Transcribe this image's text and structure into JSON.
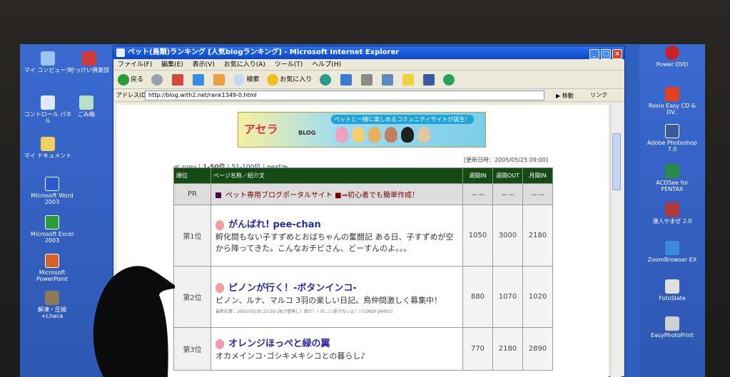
{
  "window": {
    "title": "ペット(鳥類)ランキング [人気blogランキング] - Microsoft Internet Explorer",
    "controls": [
      "_",
      "□",
      "×"
    ]
  },
  "menu": [
    "ファイル(F)",
    "編集(E)",
    "表示(V)",
    "お気に入り(A)",
    "ツール(T)",
    "ヘルプ(H)"
  ],
  "toolbar": {
    "back": "戻る",
    "search": "検索",
    "favorites": "お気に入り"
  },
  "address": {
    "label": "アドレス(D)",
    "url": "http://blog.with2.net/rank1349-0.html",
    "go": "移動",
    "links": "リンク"
  },
  "banner": {
    "logo": "アセラ",
    "blog": "BLOG",
    "tagline": "ペットと一緒に楽しめるコミュニティサイトが誕生！"
  },
  "nav": {
    "prev": "≪ prev",
    "current": "1-50位",
    "next_range": "51-100位",
    "next": "next≫"
  },
  "updated": "[更新日時：2005/05/25 09:00]",
  "table": {
    "headers": [
      "順位",
      "ページ名称／紹介文",
      "週間IN",
      "週間OUT",
      "月間IN"
    ],
    "pr": {
      "rank": "PR",
      "text": "ペット専用ブログポータルサイト ■⇒初心者でも簡単作成！",
      "values": [
        "－－",
        "－－",
        "－－"
      ]
    },
    "rows": [
      {
        "rank": "第1位",
        "title": "がんばれ! pee-chan",
        "desc": "孵化間もない子すずめとおばちゃんの奮闘記 ある日、子すずめが空から降ってきた。こんなおチビさん、どーすんのよ。。。",
        "recent": "",
        "in": "1050",
        "out": "3000",
        "month": "2180"
      },
      {
        "rank": "第2位",
        "title": "ピノンが行く！-ボタンインコ-",
        "desc": "ピノン、ルナ、マルコ 3羽の楽しい日記。鳥仲間激しく募集中！",
        "recent": "最新記事：2005/05/30 23:59 (急げ冒険し！紹介！) (5…) (あげないよ！) [CINDY JAYRO]",
        "in": "880",
        "out": "1070",
        "month": "1020"
      },
      {
        "rank": "第3位",
        "title": "オレンジほっぺと緑の翼",
        "desc": "オカメインコ･ゴシキメキシコとの暮らし♪",
        "recent": "",
        "in": "770",
        "out": "2180",
        "month": "2890"
      }
    ]
  },
  "desktop_left": [
    "マイ コンピュータ",
    "せっけい倶楽部",
    "コントロール パネル",
    "ごみ箱",
    "マイ ドキュメント",
    "Microsoft Word 2003",
    "Microsoft Excel 2003",
    "Microsoft PowerPoint",
    "解凍・圧縮 +Lhaca"
  ],
  "desktop_right": [
    "Power DVD",
    "Roxio Easy CD & DV..",
    "Adobe Photoshop 7.0",
    "ACDSee for PENTAX",
    "達人やまぜ 2.0",
    "ZoomBrowser EX",
    "FotoSlate",
    "EasyPhotoPrint"
  ],
  "colors": {
    "title_blue": "#0b47c9",
    "header_green": "#144b14",
    "link_blue": "#2a2aa8"
  }
}
